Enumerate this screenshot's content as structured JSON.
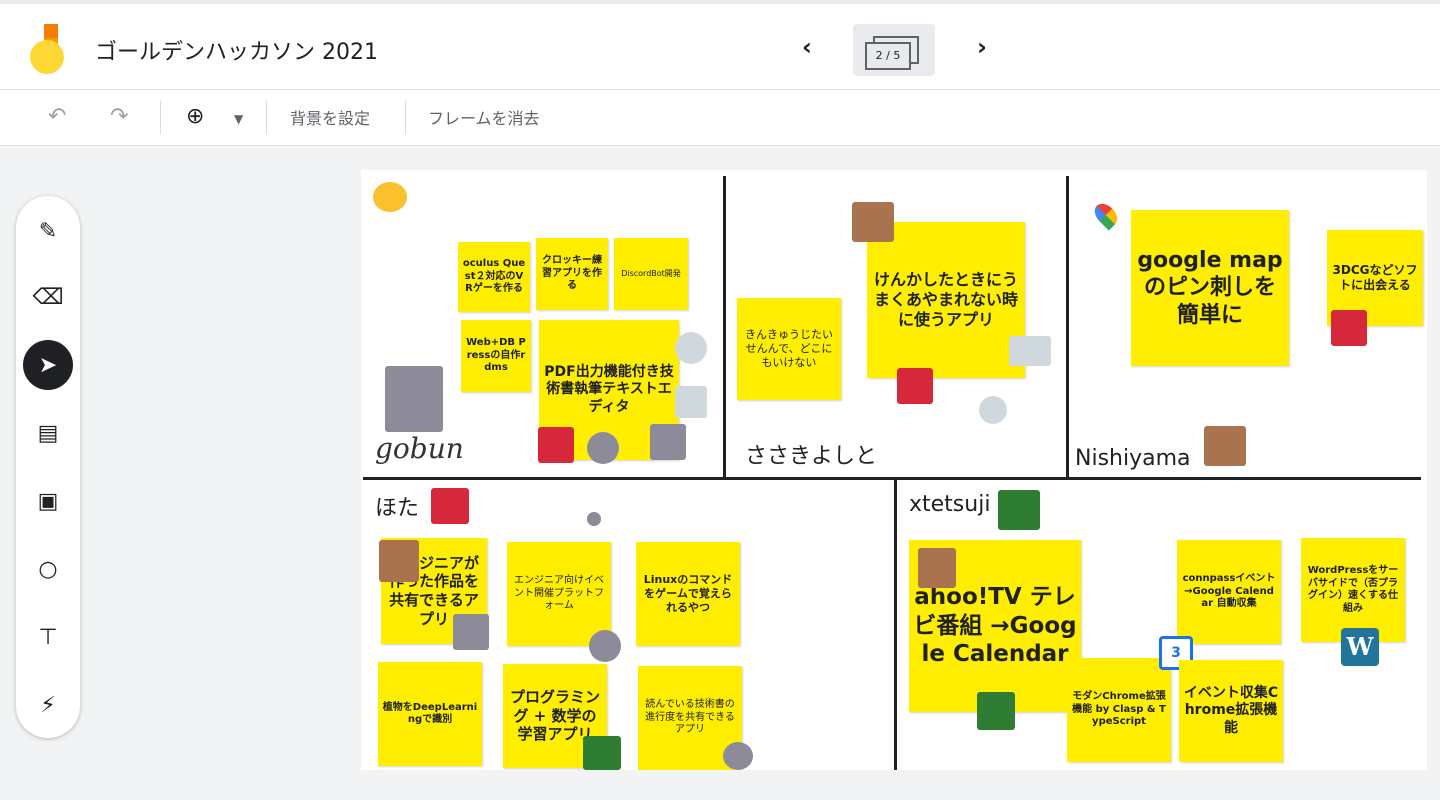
{
  "header": {
    "title": "ゴールデンハッカソン 2021",
    "frame_indicator": "2 / 5",
    "prev_icon": "chevron-left-icon",
    "next_icon": "chevron-right-icon"
  },
  "toolbar": {
    "undo_icon": "undo-icon",
    "redo_icon": "redo-icon",
    "zoom_icon": "zoom-in-icon",
    "set_background_label": "背景を設定",
    "clear_frame_label": "フレームを消去"
  },
  "sidebar": {
    "tools": [
      "pen-icon",
      "eraser-icon",
      "select-icon",
      "sticky-note-icon",
      "image-icon",
      "shape-circle-icon",
      "text-box-icon",
      "laser-icon"
    ],
    "active_tool": "select-icon"
  },
  "board": {
    "sections": {
      "top_left": {
        "label": ""
      },
      "top_middle": {
        "label": "ささきよしと"
      },
      "top_right": {
        "label": "Nishiyama"
      },
      "bottom_left": {
        "label": "ほた"
      },
      "bottom_right": {
        "label": "xtetsuji"
      }
    },
    "notes": {
      "oculus": "oculus Quest２対応のVRゲーを作る",
      "crocky": "クロッキー練習アプリを作る",
      "discord": "DiscordBot開発",
      "webdb": "Web+DB Pressの自作rdms",
      "pdf": "PDF出力機能付き技術書執筆テキストエディタ",
      "kinkyu": "きんきゅうじたいせんんで、どこにもいけない",
      "kenka": "けんかしたときにうまくあやまれない時に使うアプリ",
      "gmap": "google mapのピン刺しを簡単に",
      "dcg": "3DCGなどソフトに出会える",
      "engineer_share": "エンジニアが作った作品を共有できるアプリ",
      "engineer_event": "エンジニア向けイベント開催プラットフォーム",
      "linux": "Linuxのコマンドをゲームで覚えられるやつ",
      "plant": "植物をDeepLearningで識別",
      "programming": "プログラミング + 数学の学習アプリ",
      "reading": "読んでいる技術書の進行度を共有できるアプリ",
      "yahoo": "ahoo!TV テレビ番組 →Google Calendar",
      "connpass": "connpassイベント→Google Calendar 自動収集",
      "wordpress": "WordPressをサーバサイドで（否プラグイン）速くする仕組み",
      "modern_chrome": "モダンChrome拡張機能 by Clasp & TypeScript",
      "event_chrome": "イベント収集Chrome拡張機能"
    },
    "signature": "gobun",
    "calendar_icon_text": "3",
    "wordpress_icon_text": "W"
  }
}
